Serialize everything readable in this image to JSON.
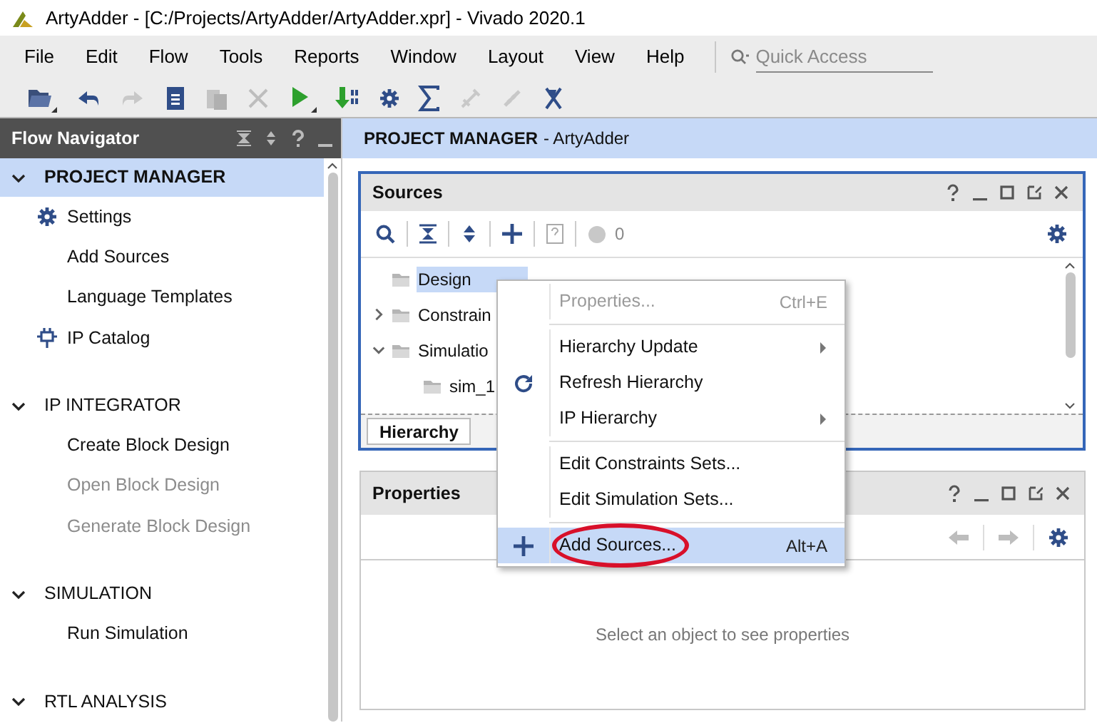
{
  "window": {
    "title": "ArtyAdder - [C:/Projects/ArtyAdder/ArtyAdder.xpr] - Vivado 2020.1"
  },
  "menu": [
    {
      "label": "File"
    },
    {
      "label": "Edit"
    },
    {
      "label": "Flow"
    },
    {
      "label": "Tools"
    },
    {
      "label": "Reports"
    },
    {
      "label": "Window"
    },
    {
      "label": "Layout"
    },
    {
      "label": "View"
    },
    {
      "label": "Help"
    }
  ],
  "quick_access": {
    "placeholder": "Quick Access"
  },
  "flow_navigator": {
    "title": "Flow Navigator",
    "sections": [
      {
        "label": "PROJECT MANAGER",
        "expanded": true,
        "selected": true,
        "items": [
          {
            "label": "Settings",
            "kind": "gear",
            "disabled": false
          },
          {
            "label": "Add Sources",
            "kind": "plain",
            "disabled": false
          },
          {
            "label": "Language Templates",
            "kind": "plain",
            "disabled": false
          },
          {
            "label": "IP Catalog",
            "kind": "chip",
            "disabled": false
          }
        ]
      },
      {
        "label": "IP INTEGRATOR",
        "expanded": true,
        "selected": false,
        "items": [
          {
            "label": "Create Block Design",
            "kind": "plain",
            "disabled": false
          },
          {
            "label": "Open Block Design",
            "kind": "plain",
            "disabled": true
          },
          {
            "label": "Generate Block Design",
            "kind": "plain",
            "disabled": true
          }
        ]
      },
      {
        "label": "SIMULATION",
        "expanded": true,
        "selected": false,
        "items": [
          {
            "label": "Run Simulation",
            "kind": "plain",
            "disabled": false
          }
        ]
      },
      {
        "label": "RTL ANALYSIS",
        "expanded": true,
        "selected": false
      }
    ]
  },
  "main_header": {
    "title": "PROJECT MANAGER",
    "subtitle": "- ArtyAdder"
  },
  "sources": {
    "title": "Sources",
    "badge_count": "0",
    "tree": [
      {
        "label": "Design",
        "selected": true
      },
      {
        "label": "Constrain",
        "selected": false,
        "expanded": false
      },
      {
        "label": "Simulatio",
        "selected": false,
        "expanded": true,
        "children": [
          {
            "label": "sim_1",
            "selected": false
          }
        ]
      }
    ],
    "tabs": [
      {
        "label": "Hierarchy",
        "selected": true
      }
    ]
  },
  "context_menu": {
    "groups": [
      [
        {
          "label": "Properties...",
          "shortcut": "Ctrl+E",
          "disabled": true,
          "selected": false,
          "submenu": false,
          "kind": "plain"
        }
      ],
      [
        {
          "label": "Hierarchy Update",
          "disabled": false,
          "selected": false,
          "submenu": true,
          "kind": "plain"
        },
        {
          "label": "Refresh Hierarchy",
          "disabled": false,
          "selected": false,
          "submenu": false,
          "kind": "refresh"
        },
        {
          "label": "IP Hierarchy",
          "disabled": false,
          "selected": false,
          "submenu": true,
          "kind": "plain"
        }
      ],
      [
        {
          "label": "Edit Constraints Sets...",
          "disabled": false,
          "selected": false,
          "submenu": false,
          "kind": "plain"
        },
        {
          "label": "Edit Simulation Sets...",
          "disabled": false,
          "selected": false,
          "submenu": false,
          "kind": "plain"
        }
      ],
      [
        {
          "label": "Add Sources...",
          "shortcut": "Alt+A",
          "disabled": false,
          "selected": true,
          "submenu": false,
          "kind": "plus",
          "circled": true
        }
      ]
    ]
  },
  "properties": {
    "title": "Properties",
    "empty_message": "Select an object to see properties"
  }
}
